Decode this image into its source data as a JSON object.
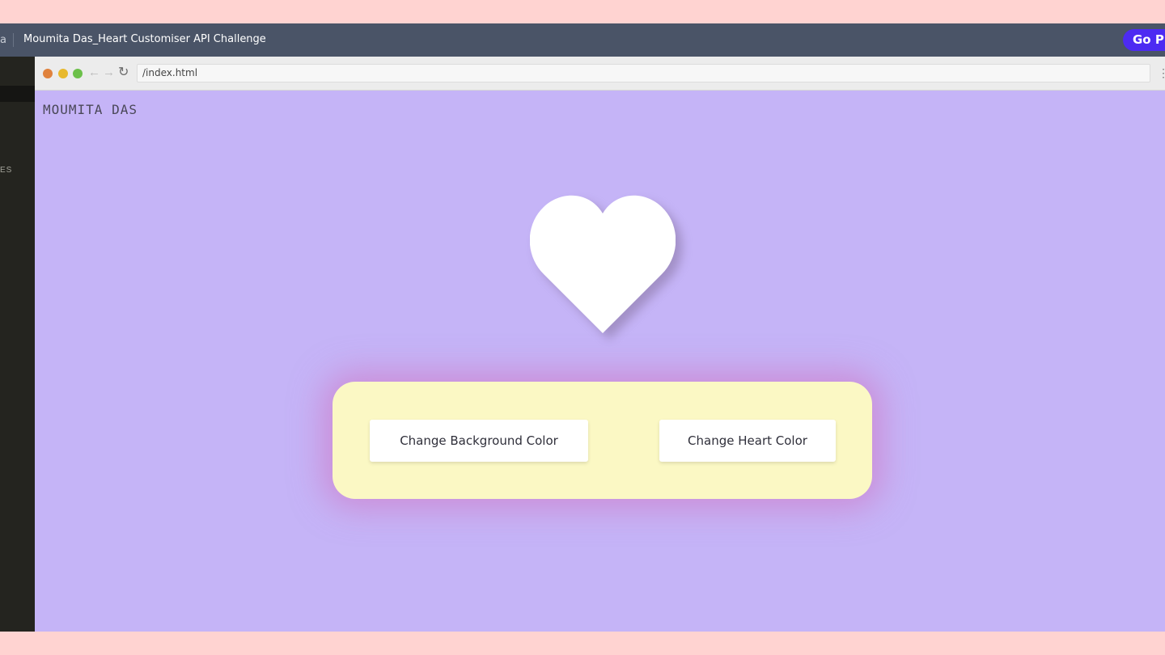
{
  "app": {
    "breadcrumb_prefix": "a",
    "title": "Moumita Das_Heart Customiser API Challenge",
    "go_pro_label": "Go Pr"
  },
  "sidebar": {
    "label": "ES"
  },
  "browser": {
    "url": "/index.html"
  },
  "page": {
    "author": "MOUMITA DAS",
    "background_color": "#c5b4f7",
    "heart_color": "#ffffff",
    "panel_color": "#fbf8c4",
    "buttons": {
      "change_background": "Change Background Color",
      "change_heart": "Change Heart Color"
    }
  },
  "icons": {
    "back": "arrow-left-icon",
    "forward": "arrow-right-icon",
    "reload": "reload-icon",
    "menu": "more-vertical-icon"
  }
}
